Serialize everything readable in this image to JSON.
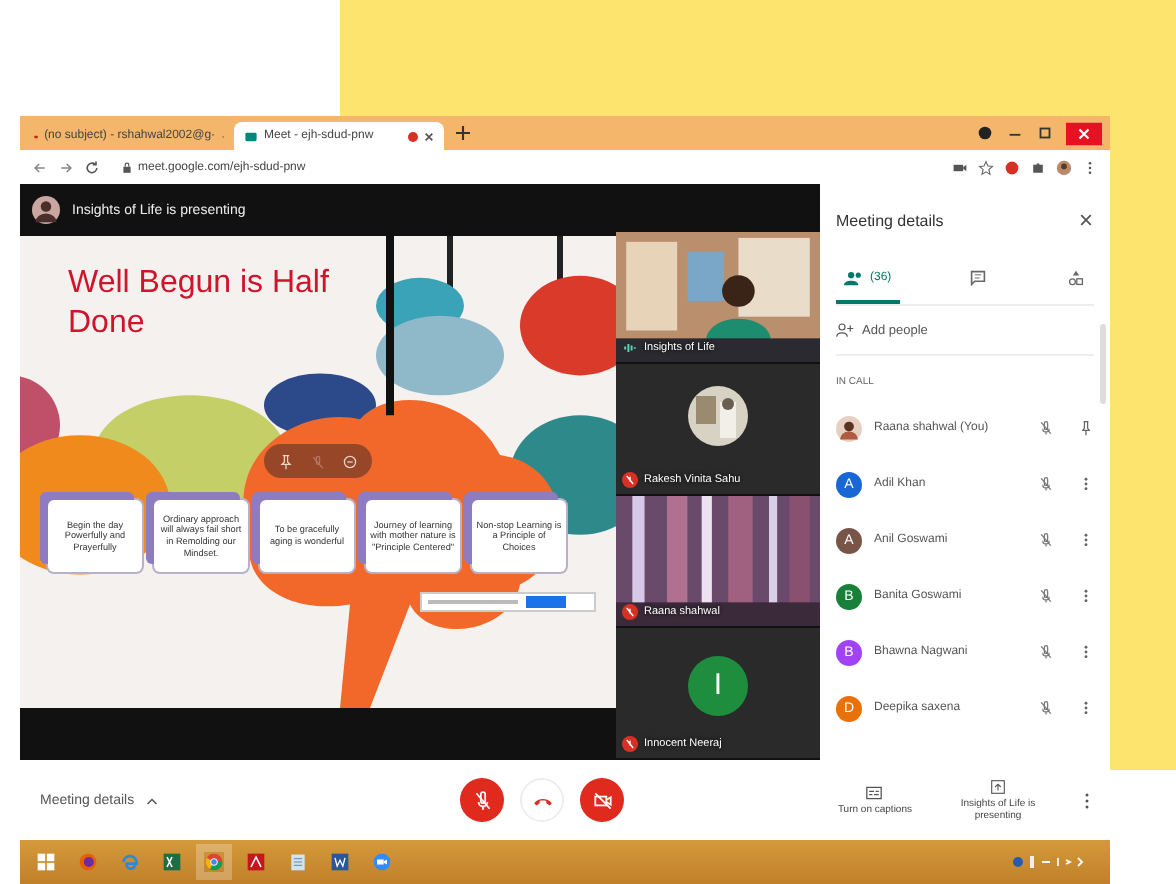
{
  "browser": {
    "tabs": [
      {
        "title": "(no subject) - rshahwal2002@g·",
        "selected": false,
        "recording": false
      },
      {
        "title": "Meet - ejh-sdud-pnw",
        "selected": true,
        "recording": true
      }
    ],
    "url": "meet.google.com/ejh-sdud-pnw"
  },
  "presenter_banner": "Insights of Life is presenting",
  "slide": {
    "title": "Well Begun is Half Done",
    "cards": [
      "Begin the day Powerfully and Prayerfully",
      "Ordinary approach will always fail short in Remolding our Mindset.",
      "To be gracefully aging is wonderful",
      "Journey of learning with mother nature is \"Principle Centered\"",
      "Non-stop Learning is a Principle of Choices"
    ]
  },
  "tiles": [
    {
      "name": "Insights of Life",
      "kind": "room",
      "muted": false
    },
    {
      "name": "Rakesh Vinita Sahu",
      "kind": "portrait",
      "muted": true
    },
    {
      "name": "Raana shahwal",
      "kind": "curtains",
      "muted": true
    },
    {
      "name": "Innocent Neeraj",
      "kind": "initial",
      "initial": "I",
      "color": "#1e8e3e",
      "muted": true
    }
  ],
  "panel": {
    "title": "Meeting details",
    "tabs": [
      {
        "kind": "people",
        "label": "(36)",
        "selected": true
      },
      {
        "kind": "chat",
        "selected": false
      },
      {
        "kind": "activities",
        "selected": false
      }
    ],
    "add_people": "Add people",
    "section": "IN CALL",
    "participants": [
      {
        "name": "Raana shahwal (You)",
        "pinnable": true
      },
      {
        "name": "Adil Khan",
        "kind": "initial",
        "initial": "A",
        "color": "#1967d2",
        "pinnable": false
      },
      {
        "name": "Anil Goswami",
        "kind": "initial",
        "initial": "A",
        "color": "#795548",
        "pinnable": false
      },
      {
        "name": "Banita Goswami",
        "kind": "initial",
        "initial": "B",
        "color": "#188038",
        "pinnable": false
      },
      {
        "name": "Bhawna Nagwani",
        "kind": "initial",
        "initial": "B",
        "color": "#a142f4",
        "pinnable": false
      },
      {
        "name": "Deepika saxena",
        "kind": "initial",
        "initial": "D",
        "color": "#e8710a",
        "pinnable": false
      }
    ]
  },
  "bottom_bar": {
    "details_label": "Meeting details",
    "mic_on": false,
    "camera_on": false,
    "captions_label": "Turn on captions",
    "presenting_label": "Insights of Life is presenting"
  }
}
